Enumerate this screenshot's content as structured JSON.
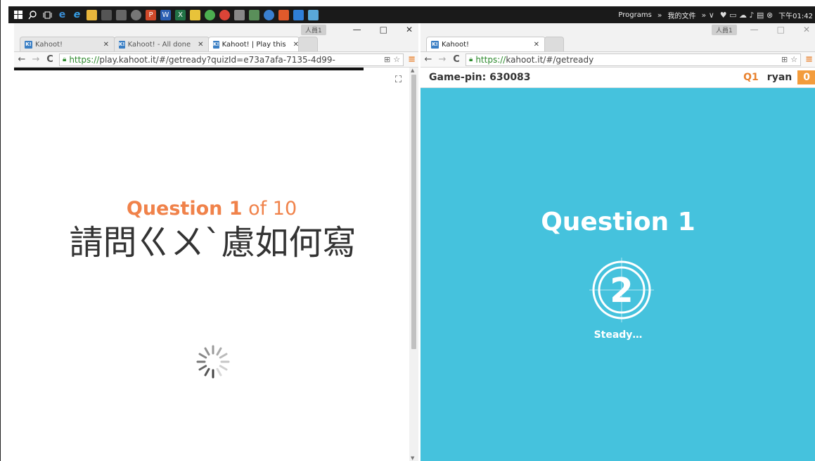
{
  "taskbar": {
    "programs_label": "Programs",
    "folder_label": "我的文件",
    "clock": "下午01:42"
  },
  "left_window": {
    "people_label": "人員1",
    "tabs": [
      {
        "label": "Kahoot!"
      },
      {
        "label": "Kahoot! - All done"
      },
      {
        "label": "Kahoot! | Play this"
      }
    ],
    "url_scheme": "https://",
    "url_rest": "play.kahoot.it/#/getready?quizId=e73a7afa-7135-4d99-",
    "question_label": "Question 1",
    "question_of": "of 10",
    "question_text": "請問ㄍㄨˋ慮如何寫"
  },
  "right_window": {
    "people_label": "人員1",
    "tabs": [
      {
        "label": "Kahoot!"
      }
    ],
    "url_scheme": "https://",
    "url_rest": "kahoot.it/#/getready",
    "game_pin": "Game-pin: 630083",
    "question_indicator": "Q1",
    "player_name": "ryan",
    "score": "0",
    "stage_title": "Question 1",
    "countdown_number": "2",
    "status_text": "Steady…"
  },
  "colors": {
    "kahoot_orange": "#f0824a",
    "stage_blue": "#45c2dd",
    "score_orange": "#f39c3c"
  },
  "icons": [
    "windows-logo-icon",
    "search-icon",
    "task-view-icon",
    "edge-icon",
    "ie-icon",
    "file-explorer-icon",
    "store-icon",
    "calculator-icon",
    "photos-icon",
    "powerpoint-icon",
    "word-icon",
    "excel-icon",
    "chrome-icon",
    "fullscreen-icon",
    "spinner-icon",
    "countdown-icon",
    "lock-icon"
  ]
}
